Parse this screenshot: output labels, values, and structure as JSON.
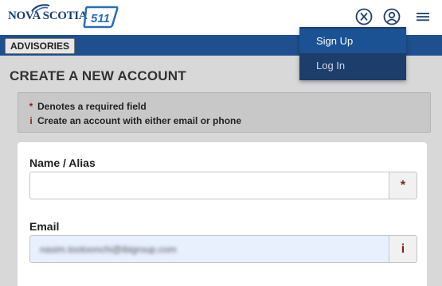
{
  "header": {
    "logo_ns_text": "NOVA SCOTIA",
    "logo_511_text": "511",
    "icons": [
      "x-twitter-icon",
      "user-circle-icon",
      "hamburger-menu-icon"
    ]
  },
  "advisories_label": "ADVISORIES",
  "page_title": "CREATE A NEW ACCOUNT",
  "info": {
    "required_symbol": "*",
    "required_text": "Denotes a required field",
    "info_symbol": "i",
    "info_text": "Create an account with either email or phone"
  },
  "form": {
    "name": {
      "label": "Name / Alias",
      "value": "",
      "addon": "*"
    },
    "email": {
      "label": "Email",
      "value": "nasim.tootoonchi@ibigroup.com",
      "addon": "i"
    }
  },
  "dropdown": {
    "signup_label": "Sign Up",
    "login_label": "Log In"
  },
  "colors": {
    "brand_blue": "#1f4f8f",
    "menu_bg": "#1d3d6b",
    "menu_active": "#1a5294",
    "required_red": "#8a1f11"
  }
}
